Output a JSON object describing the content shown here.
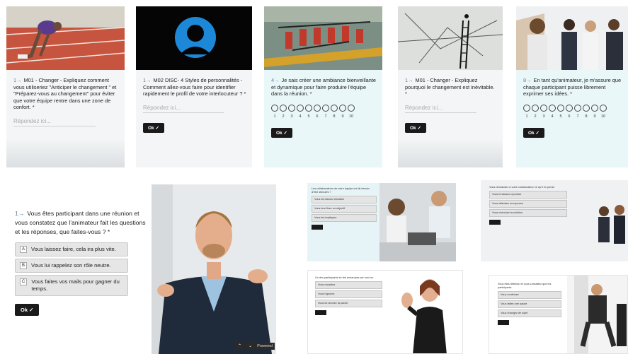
{
  "cards": [
    {
      "num": "1→",
      "question": "M01 - Changer - Expliquez comment vous utiliseriez \"Anticiper le changement \" et \"Préparez-vous au changement\" pour éviter que votre équipe rentre dans une zone de confort. *",
      "placeholder": "Répondez ici..."
    },
    {
      "num": "1→",
      "question": "M02 DISC- 4 Styles de personnalités - Comment allez-vous faire pour identifier rapidement le profil de votre interlocuteur ? *",
      "placeholder": "Répondez ici...",
      "ok": "Ok ✓"
    },
    {
      "num": "4→",
      "question": "Je sais créer une ambiance bienveillante et dynamique pour faire produire l'équipe dans la réunion. *",
      "scale": [
        "1",
        "2",
        "3",
        "4",
        "5",
        "6",
        "7",
        "8",
        "9",
        "10"
      ],
      "ok": "Ok ✓"
    },
    {
      "num": "1→",
      "question": "M01 - Changer - Expliquez pourquoi le changement est inévitable. *",
      "placeholder": "Répondez ici...",
      "ok": "Ok ✓"
    },
    {
      "num": "8→",
      "question": "En tant qu'animateur, je m'assure que chaque participant puisse librement exprimer ses idées. *",
      "scale": [
        "1",
        "2",
        "3",
        "4",
        "5",
        "6",
        "7",
        "8",
        "9",
        "10"
      ],
      "ok": "Ok ✓"
    }
  ],
  "big": {
    "num": "1→",
    "question": "Vous êtes participant dans une réunion et vous constatez que l'animateur fait les questions et les réponses, que faites-vous ? *",
    "options": [
      {
        "key": "A",
        "label": "Vous laissez faire, cela ira plus vite."
      },
      {
        "key": "B",
        "label": "Vous lui rappelez son rôle neutre."
      },
      {
        "key": "C",
        "label": "Vous faites vos mails pour gagner du temps."
      }
    ],
    "ok": "Ok ✓",
    "nav_label": "Powered"
  },
  "minis": [
    {
      "question": "Les collaborateurs de votre équipe ont-ils besoin d'être stimulés ?",
      "options": [
        "Vous les laissez travailler",
        "Vous leur fixez un objectif",
        "Vous les impliquez"
      ]
    },
    {
      "question": "Vous demandez à votre collaborateur ce qu'il en pense",
      "options": [
        "Vous le laissez répondre",
        "Vous attendez sa réponse",
        "Vous cherchez la solution"
      ]
    },
    {
      "question": "Un des participants se fait remarquer par son ton",
      "options": [
        "Vous recadrez",
        "Vous l'ignorez",
        "Vous lui donnez la parole"
      ]
    },
    {
      "question": "Vous êtes détendu et vous constatez que les participants",
      "options": [
        "Vous continuez",
        "Vous faites une pause",
        "Vous changez de sujet"
      ]
    }
  ],
  "colors": {
    "accent": "#1a1a1a",
    "cyan_card": "#e9f7f9",
    "track": "#b84a3a",
    "silhouette": "#1e88d8"
  }
}
